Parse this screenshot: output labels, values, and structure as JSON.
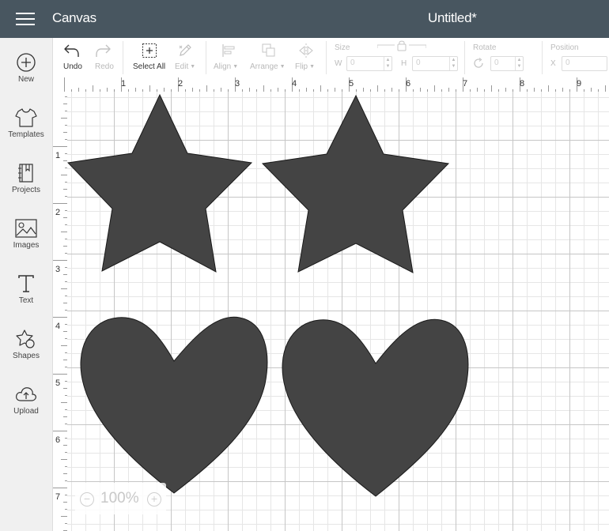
{
  "header": {
    "app_title": "Canvas",
    "doc_title": "Untitled*"
  },
  "sidebar": {
    "items": [
      {
        "label": "New",
        "icon": "plus-circle-icon"
      },
      {
        "label": "Templates",
        "icon": "shirt-icon"
      },
      {
        "label": "Projects",
        "icon": "book-icon"
      },
      {
        "label": "Images",
        "icon": "image-icon"
      },
      {
        "label": "Text",
        "icon": "text-icon"
      },
      {
        "label": "Shapes",
        "icon": "shapes-icon"
      },
      {
        "label": "Upload",
        "icon": "cloud-upload-icon"
      }
    ]
  },
  "toolbar": {
    "undo": "Undo",
    "redo": "Redo",
    "select_all": "Select All",
    "edit": "Edit",
    "align": "Align",
    "arrange": "Arrange",
    "flip": "Flip",
    "size": {
      "label": "Size",
      "w_label": "W",
      "w_value": "0",
      "h_label": "H",
      "h_value": "0"
    },
    "rotate": {
      "label": "Rotate",
      "value": "0"
    },
    "position": {
      "label": "Position",
      "x_label": "X",
      "x_value": "0"
    }
  },
  "rulers": {
    "horizontal": [
      "1",
      "2",
      "3",
      "4",
      "5",
      "6",
      "7",
      "8",
      "9"
    ],
    "vertical": [
      "1",
      "2",
      "3",
      "4",
      "5",
      "6",
      "7"
    ]
  },
  "canvas": {
    "shape_fill": "#444444",
    "shapes": [
      {
        "type": "star"
      },
      {
        "type": "star"
      },
      {
        "type": "heart"
      },
      {
        "type": "heart"
      }
    ]
  },
  "zoom": {
    "value": "100%"
  },
  "colors": {
    "header_bg": "#485660",
    "sidebar_bg": "#f0f0f0"
  }
}
